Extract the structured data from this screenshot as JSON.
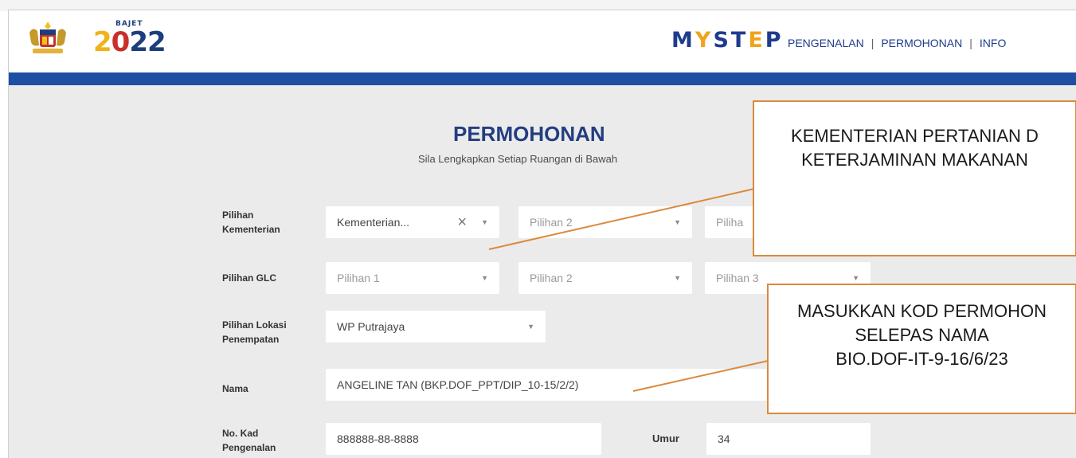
{
  "header": {
    "bajet_label": "BAJET",
    "bajet_year_a": "2",
    "bajet_year_b": "0",
    "bajet_year_c": "22",
    "brand_a": "M",
    "brand_b": "Y",
    "brand_c": "ST",
    "brand_d": "E",
    "brand_e": "P",
    "nav": [
      "PENGENALAN",
      "PERMOHONAN",
      "INFO"
    ],
    "nav_sep": "|",
    "colors": {
      "primary": "#1f4fa3",
      "accent": "#f2b21b",
      "callout_border": "#d98a3d"
    }
  },
  "form": {
    "title": "PERMOHONAN",
    "subtitle": "Sila Lengkapkan Setiap Ruangan di Bawah",
    "kementerian": {
      "label_line1": "Pilihan",
      "label_line2": "Kementerian",
      "choice1_value": "Kementerian...",
      "choice2_placeholder": "Pilihan 2",
      "choice3_placeholder": "Piliha"
    },
    "glc": {
      "label": "Pilihan GLC",
      "choice1_placeholder": "Pilihan 1",
      "choice2_placeholder": "Pilihan 2",
      "choice3_placeholder": "Pilihan 3"
    },
    "lokasi": {
      "label_line1": "Pilihan Lokasi",
      "label_line2": "Penempatan",
      "value": "WP Putrajaya"
    },
    "nama": {
      "label": "Nama",
      "value": "ANGELINE TAN (BKP.DOF_PPT/DIP_10-15/2/2)"
    },
    "ic": {
      "label_line1": "No. Kad",
      "label_line2": "Pengenalan",
      "value": "888888-88-8888"
    },
    "umur": {
      "label": "Umur",
      "value": "34"
    }
  },
  "callouts": {
    "ministry": [
      "KEMENTERIAN PERTANIAN D",
      "KETERJAMINAN MAKANAN"
    ],
    "code": [
      "MASUKKAN KOD PERMOHON",
      "SELEPAS NAMA",
      "BIO.DOF-IT-9-16/6/23"
    ]
  }
}
